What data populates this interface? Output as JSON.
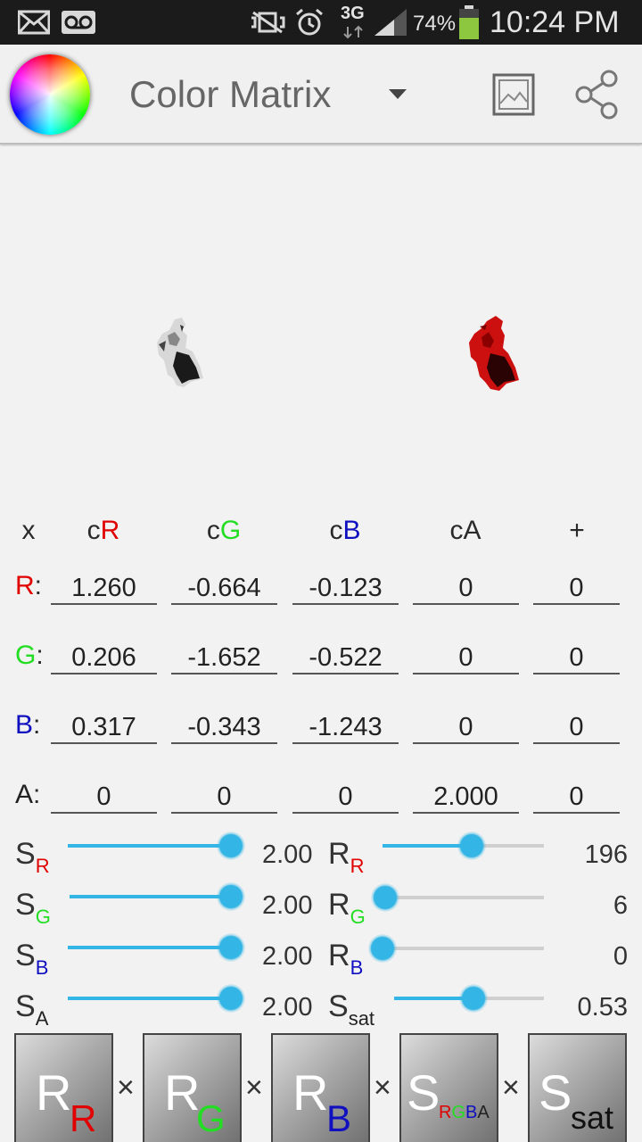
{
  "status_bar": {
    "icons": [
      "mail-icon",
      "voicemail-icon",
      "vibrate-icon",
      "alarm-icon",
      "network-3g-icon",
      "signal-icon",
      "battery-icon"
    ],
    "network_label": "3G",
    "battery_percent": "74%",
    "time": "10:24 PM"
  },
  "action_bar": {
    "title": "Color Matrix",
    "icons": [
      "color-wheel-logo",
      "dropdown-caret-icon",
      "image-icon",
      "share-icon"
    ]
  },
  "matrix": {
    "headers": {
      "x": "x",
      "c": "c",
      "cR": "R",
      "cG": "G",
      "cB": "B",
      "cA": "cA",
      "plus": "+"
    },
    "rows": [
      {
        "label": "R",
        "cells": [
          "1.260",
          "-0.664",
          "-0.123",
          "0",
          "0"
        ]
      },
      {
        "label": "G",
        "cells": [
          "0.206",
          "-1.652",
          "-0.522",
          "0",
          "0"
        ]
      },
      {
        "label": "B",
        "cells": [
          "0.317",
          "-0.343",
          "-1.243",
          "0",
          "0"
        ]
      },
      {
        "label": "A",
        "cells": [
          "0",
          "0",
          "0",
          "2.000",
          "0"
        ]
      }
    ],
    "row_colors": {
      "R": "#e00000",
      "G": "#22dd22",
      "B": "#1010c0",
      "A": "#222222"
    }
  },
  "sliders_left": [
    {
      "main": "S",
      "sub": "R",
      "sub_color": "#e00000",
      "value_text": "2.00",
      "level": 1.0
    },
    {
      "main": "S",
      "sub": "G",
      "sub_color": "#22dd22",
      "value_text": "2.00",
      "level": 1.0
    },
    {
      "main": "S",
      "sub": "B",
      "sub_color": "#1010c0",
      "value_text": "2.00",
      "level": 1.0
    },
    {
      "main": "S",
      "sub": "A",
      "sub_color": "#222222",
      "value_text": "2.00",
      "level": 1.0
    }
  ],
  "sliders_right": [
    {
      "main": "R",
      "sub": "R",
      "sub_color": "#e00000",
      "value_text": "196",
      "level": 0.55
    },
    {
      "main": "R",
      "sub": "G",
      "sub_color": "#22dd22",
      "value_text": "6",
      "level": 0.0
    },
    {
      "main": "R",
      "sub": "B",
      "sub_color": "#1010c0",
      "value_text": "0",
      "level": 0.0
    },
    {
      "main": "S",
      "sub": "sat",
      "sub_color": "#222222",
      "value_text": "0.53",
      "level": 0.53
    }
  ],
  "pipeline": {
    "times_symbol": "×",
    "tiles": [
      {
        "main": "R",
        "sub": "R",
        "sub_color": "#e00000"
      },
      {
        "main": "R",
        "sub": "G",
        "sub_color": "#22dd22"
      },
      {
        "main": "R",
        "sub": "B",
        "sub_color": "#1010c0"
      },
      {
        "main": "S",
        "sub_parts": [
          {
            "t": "R",
            "c": "#e00000"
          },
          {
            "t": "G",
            "c": "#22dd22"
          },
          {
            "t": "B",
            "c": "#1010c0"
          },
          {
            "t": "A",
            "c": "#222222"
          }
        ]
      },
      {
        "main": "S",
        "sub": "sat",
        "sub_color": "#111111"
      }
    ]
  }
}
